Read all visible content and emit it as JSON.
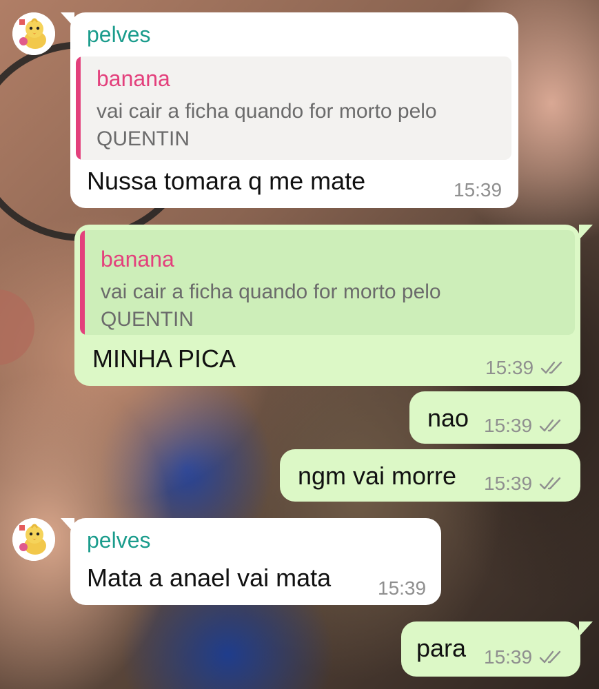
{
  "messages": [
    {
      "sender": "pelves",
      "quote": {
        "author": "banana",
        "text_line1": "vai cair a ficha quando for morto pelo",
        "text_line2": "QUENTIN"
      },
      "text": "Nussa tomara q me mate",
      "time": "15:39"
    },
    {
      "quote": {
        "author": "banana",
        "text_line1": "vai cair a ficha quando for morto pelo",
        "text_line2": "QUENTIN"
      },
      "text": "MINHA PICA",
      "time": "15:39"
    },
    {
      "text": "nao",
      "time": "15:39"
    },
    {
      "text": "ngm vai morre",
      "time": "15:39"
    },
    {
      "sender": "pelves",
      "text": "Mata a anael vai mata",
      "time": "15:39"
    },
    {
      "text": "para",
      "time": "15:39"
    }
  ],
  "icons": {
    "avatar": "duck-avatar-icon",
    "read_receipt": "double-check-icon"
  },
  "colors": {
    "incoming_bubble": "#ffffff",
    "outgoing_bubble": "#dcf8c6",
    "sender_name": "#1a9c8c",
    "quote_author": "#e3407c",
    "time": "#8f8f8f"
  }
}
